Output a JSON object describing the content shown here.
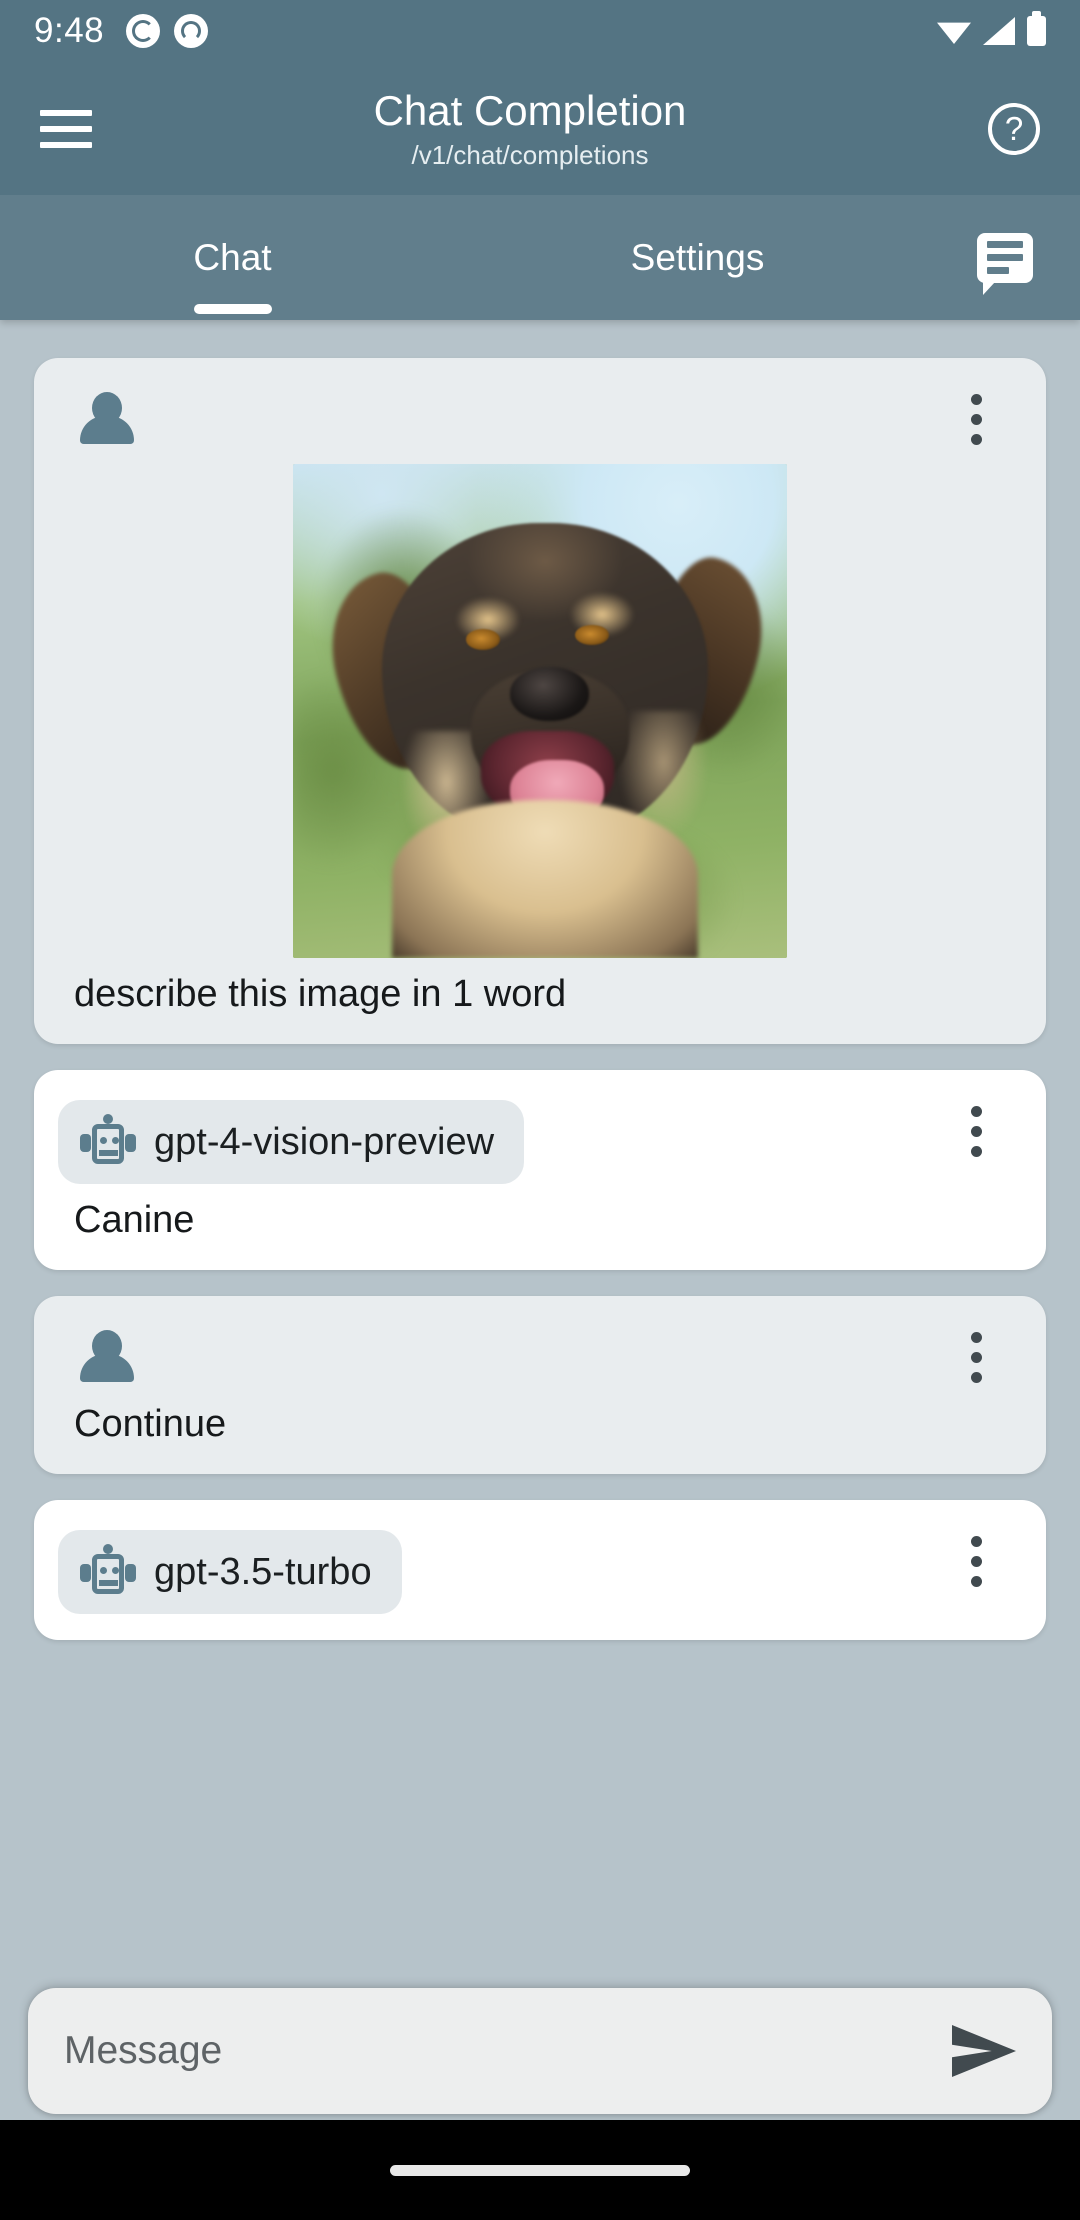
{
  "status_bar": {
    "time": "9:48",
    "notification_icons": [
      "spiral-notification-icon",
      "face-notification-icon"
    ],
    "right_icons": [
      "wifi-icon",
      "signal-icon",
      "battery-icon"
    ]
  },
  "app_bar": {
    "menu_icon": "hamburger-menu-icon",
    "title": "Chat Completion",
    "subtitle": "/v1/chat/completions",
    "help_icon": "help-circle-icon",
    "help_glyph": "?"
  },
  "tabs": {
    "items": [
      {
        "label": "Chat",
        "active": true
      },
      {
        "label": "Settings",
        "active": false
      }
    ],
    "action_icon": "chat-bubble-icon"
  },
  "messages": [
    {
      "role": "user",
      "avatar_icon": "person-avatar-icon",
      "menu_icon": "more-vertical-icon",
      "has_image": true,
      "image_alt": "photograph of a brown and black dog with mouth open outdoors",
      "text": "describe this image in 1 word"
    },
    {
      "role": "assistant",
      "model": "gpt-4-vision-preview",
      "model_icon": "robot-icon",
      "menu_icon": "more-vertical-icon",
      "has_image": false,
      "text": "Canine"
    },
    {
      "role": "user",
      "avatar_icon": "person-avatar-icon",
      "menu_icon": "more-vertical-icon",
      "has_image": false,
      "text": "Continue"
    },
    {
      "role": "assistant",
      "model": "gpt-3.5-turbo",
      "model_icon": "robot-icon",
      "menu_icon": "more-vertical-icon",
      "has_image": false,
      "text": ""
    }
  ],
  "composer": {
    "placeholder": "Message",
    "value": "",
    "send_icon": "send-icon"
  },
  "nav_bar": {
    "gesture_pill": "home-gesture-pill"
  },
  "colors": {
    "status_bar": "#547483",
    "app_bar": "#547483",
    "tab_bar": "#617e8c",
    "page_background": "#b6c3ca",
    "user_card": "#e9edef",
    "assistant_card": "#ffffff",
    "badge_background": "#e3e8eb",
    "icon_slate": "#5c7d8d",
    "icon_dark": "#414a4f",
    "text_primary": "#16191b",
    "placeholder": "#5e6366",
    "nav_bar": "#000000"
  }
}
